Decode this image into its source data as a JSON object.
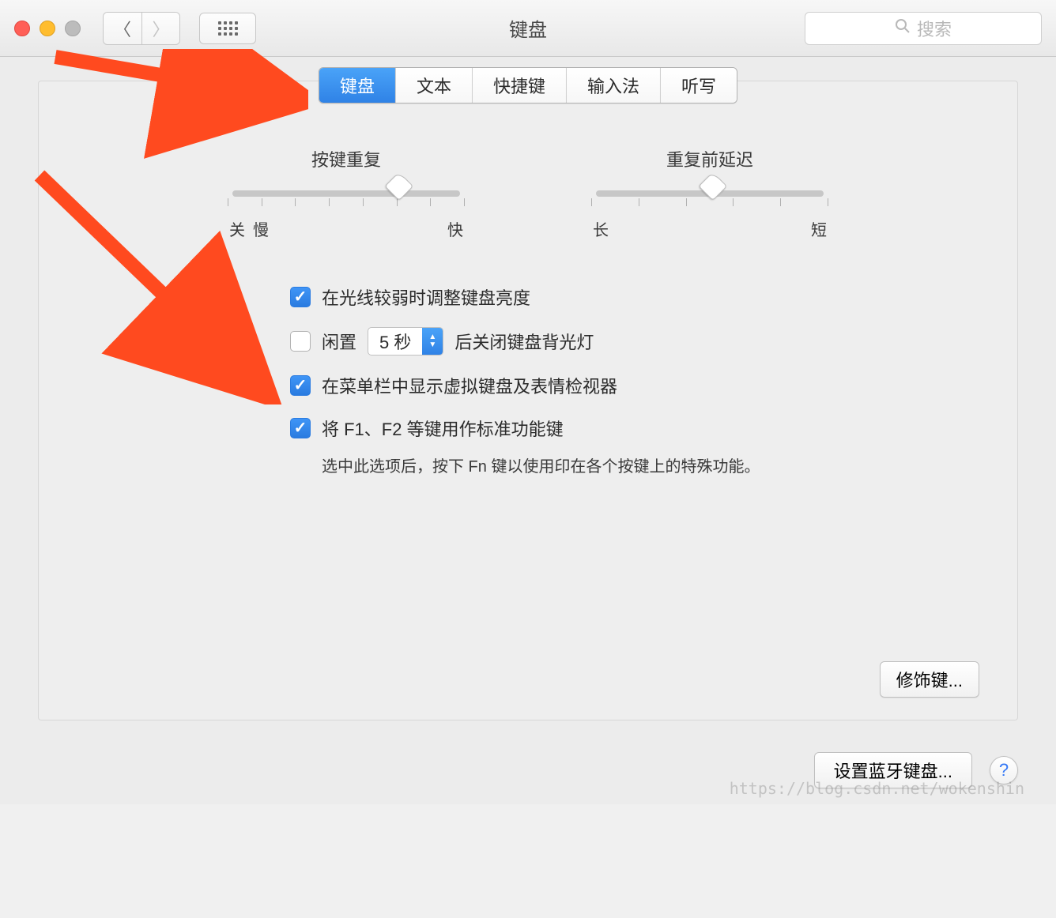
{
  "window": {
    "title": "键盘"
  },
  "search": {
    "placeholder": "搜索"
  },
  "tabs": [
    "键盘",
    "文本",
    "快捷键",
    "输入法",
    "听写"
  ],
  "sliders": {
    "repeat": {
      "title": "按键重复",
      "left_outer": "关",
      "left": "慢",
      "right": "快"
    },
    "delay": {
      "title": "重复前延迟",
      "left": "长",
      "right": "短"
    }
  },
  "options": {
    "brightness": "在光线较弱时调整键盘亮度",
    "idle_prefix": "闲置",
    "idle_select": "5 秒",
    "idle_suffix": "后关闭键盘背光灯",
    "menubar": "在菜单栏中显示虚拟键盘及表情检视器",
    "fn_keys": "将 F1、F2 等键用作标准功能键",
    "fn_desc": "选中此选项后，按下 Fn 键以使用印在各个按键上的特殊功能。"
  },
  "buttons": {
    "modifier": "修饰键...",
    "bluetooth": "设置蓝牙键盘...",
    "help": "?"
  },
  "watermark": "https://blog.csdn.net/wokenshin"
}
